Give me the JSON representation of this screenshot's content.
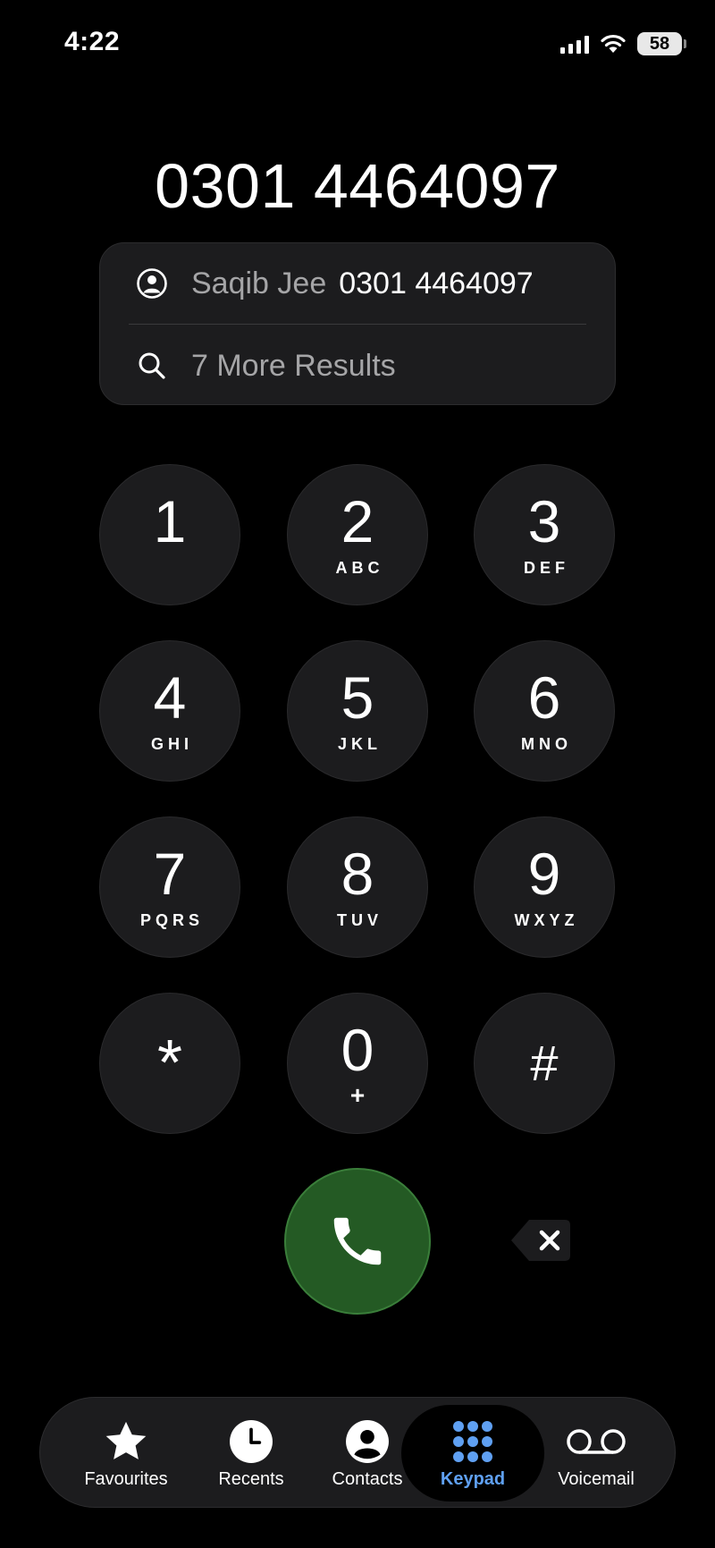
{
  "status_bar": {
    "time": "4:22",
    "battery_level": "58",
    "signal_bars": 4,
    "wifi": true
  },
  "dialer": {
    "dialed_number": "0301 4464097"
  },
  "suggestions": {
    "contact_name": "Saqib Jee",
    "contact_number": "0301 4464097",
    "more_results_label": "7 More Results"
  },
  "keypad": {
    "keys": [
      {
        "digit": "1",
        "letters": ""
      },
      {
        "digit": "2",
        "letters": "ABC"
      },
      {
        "digit": "3",
        "letters": "DEF"
      },
      {
        "digit": "4",
        "letters": "GHI"
      },
      {
        "digit": "5",
        "letters": "JKL"
      },
      {
        "digit": "6",
        "letters": "MNO"
      },
      {
        "digit": "7",
        "letters": "PQRS"
      },
      {
        "digit": "8",
        "letters": "TUV"
      },
      {
        "digit": "9",
        "letters": "WXYZ"
      },
      {
        "digit": "*",
        "letters": ""
      },
      {
        "digit": "0",
        "letters": "+"
      },
      {
        "digit": "#",
        "letters": ""
      }
    ]
  },
  "actions": {
    "call_icon": "phone-icon",
    "delete_icon": "backspace-icon",
    "call_color": "#245a24"
  },
  "tab_bar": {
    "active_color": "#5fa0f2",
    "tabs": [
      {
        "label": "Favourites",
        "icon": "star-icon",
        "active": false
      },
      {
        "label": "Recents",
        "icon": "clock-icon",
        "active": false
      },
      {
        "label": "Contacts",
        "icon": "person-circle-icon",
        "active": false
      },
      {
        "label": "Keypad",
        "icon": "keypad-grid-icon",
        "active": true
      },
      {
        "label": "Voicemail",
        "icon": "voicemail-icon",
        "active": false
      }
    ]
  }
}
